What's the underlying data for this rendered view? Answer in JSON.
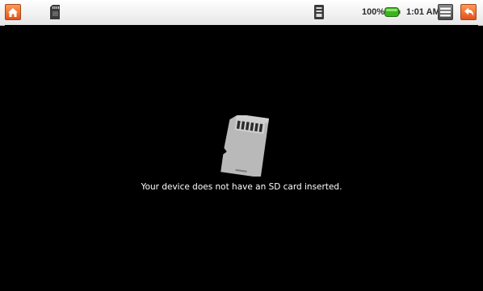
{
  "status_bar": {
    "battery_percent": "100%",
    "time": "1:01 AM",
    "icons": {
      "home": "home-icon",
      "sd_status": "sd-card-icon",
      "signal": "signal-icon",
      "battery": "battery-icon",
      "menu": "menu-icon",
      "back": "back-icon"
    },
    "colors": {
      "orange_button": "#e3521a",
      "battery_fill": "#3cb41e"
    }
  },
  "main": {
    "message": "Your device does not have an SD card inserted.",
    "illustration": "sd-card-icon"
  }
}
